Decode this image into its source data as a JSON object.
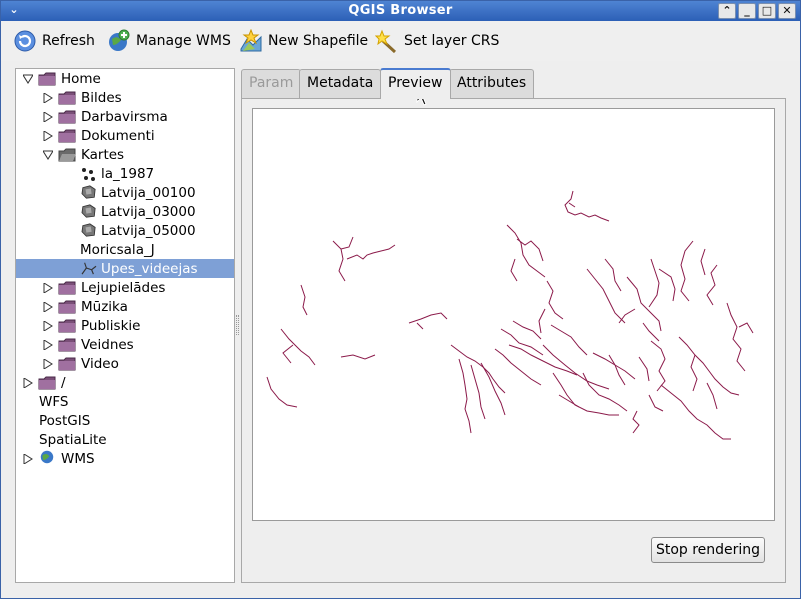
{
  "window": {
    "title": "QGIS Browser"
  },
  "toolbar": {
    "refresh": "Refresh",
    "manage_wms": "Manage WMS",
    "new_shapefile": "New Shapefile",
    "set_layer_crs": "Set layer CRS"
  },
  "tree": {
    "items": [
      {
        "label": "Home",
        "icon": "folder-icon",
        "expanded": true
      },
      {
        "label": "Bildes",
        "icon": "folder-icon"
      },
      {
        "label": "Darbavirsma",
        "icon": "folder-icon"
      },
      {
        "label": "Dokumenti",
        "icon": "folder-icon"
      },
      {
        "label": "Kartes",
        "icon": "folder-open-icon",
        "expanded": true
      },
      {
        "label": "la_1987",
        "icon": "point-layer-icon"
      },
      {
        "label": "Latvija_00100",
        "icon": "raster-layer-icon"
      },
      {
        "label": "Latvija_03000",
        "icon": "raster-layer-icon"
      },
      {
        "label": "Latvija_05000",
        "icon": "raster-layer-icon"
      },
      {
        "label": "Moricsala_J",
        "icon": ""
      },
      {
        "label": "Upes_videejas",
        "icon": "line-layer-icon",
        "selected": true
      },
      {
        "label": "Lejupielādes",
        "icon": "folder-icon"
      },
      {
        "label": "Mūzika",
        "icon": "folder-icon"
      },
      {
        "label": "Publiskie",
        "icon": "folder-icon"
      },
      {
        "label": "Veidnes",
        "icon": "folder-icon"
      },
      {
        "label": "Video",
        "icon": "folder-icon"
      },
      {
        "label": "/",
        "icon": "folder-icon"
      },
      {
        "label": "WFS",
        "icon": ""
      },
      {
        "label": "PostGIS",
        "icon": ""
      },
      {
        "label": "SpatiaLite",
        "icon": ""
      },
      {
        "label": "WMS",
        "icon": "globe-icon"
      }
    ]
  },
  "tabs": [
    {
      "label": "Param",
      "state": "disabled"
    },
    {
      "label": "Metadata",
      "state": "normal"
    },
    {
      "label": "Preview",
      "state": "active"
    },
    {
      "label": "Attributes",
      "state": "normal"
    }
  ],
  "preview": {
    "line_color": "#8b1a4a"
  },
  "buttons": {
    "stop_rendering": "Stop rendering"
  },
  "colors": {
    "titlebar": "#3a6cc0",
    "selection": "#7ea0d6",
    "folder": "#8a5a88"
  }
}
